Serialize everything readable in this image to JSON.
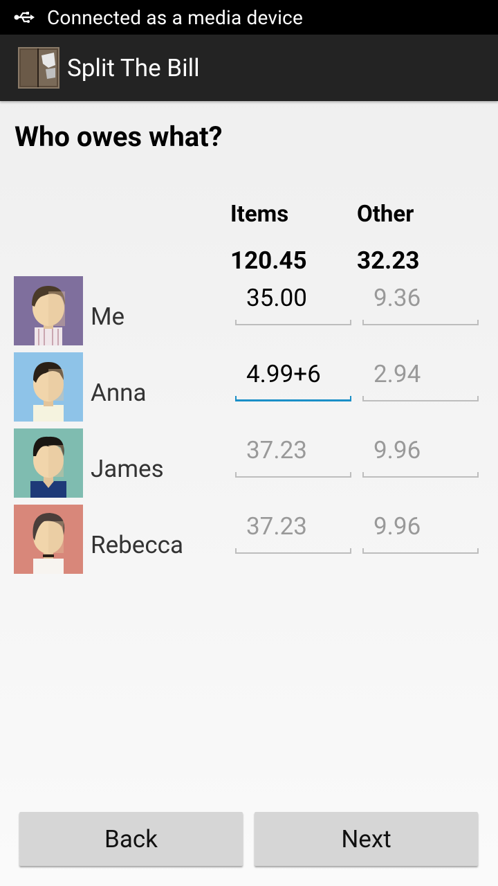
{
  "status_bar": {
    "icon": "usb-icon",
    "text": "Connected as a media device"
  },
  "action_bar": {
    "icon": "app-icon",
    "title": "Split The Bill"
  },
  "heading": "Who owes what?",
  "columns": {
    "items": "Items",
    "other": "Other"
  },
  "totals": {
    "items": "120.45",
    "other": "32.23"
  },
  "people": [
    {
      "name": "Me",
      "items": "35.00",
      "other": "9.36",
      "avatar_bg": "#7f6f9d"
    },
    {
      "name": "Anna",
      "items": "4.99+6",
      "other": "2.94",
      "avatar_bg": "#8ec3e8"
    },
    {
      "name": "James",
      "items": "37.23",
      "other": "9.96",
      "avatar_bg": "#7fbcb0"
    },
    {
      "name": "Rebecca",
      "items": "37.23",
      "other": "9.96",
      "avatar_bg": "#d8877a"
    }
  ],
  "buttons": {
    "back": "Back",
    "next": "Next"
  },
  "colors": {
    "focus_accent": "#1a8fc7",
    "status_bar": "#000000",
    "action_bar": "#232323"
  }
}
